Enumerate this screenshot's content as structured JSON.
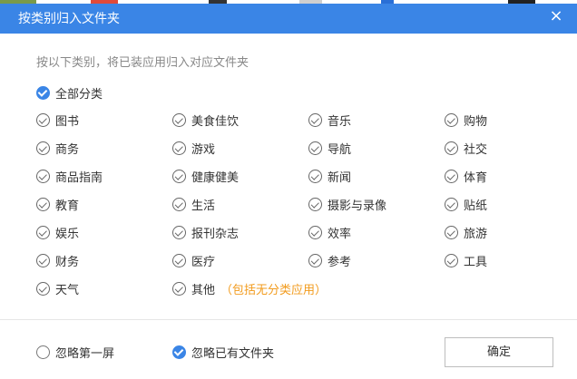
{
  "dialog": {
    "title": "按类别归入文件夹",
    "close_glyph": "×",
    "subtitle": "按以下类别，将已装应用归入对应文件夹",
    "select_all": {
      "label": "全部分类",
      "checked": true
    },
    "categories": [
      {
        "label": "图书",
        "checked": true
      },
      {
        "label": "美食佳饮",
        "checked": true
      },
      {
        "label": "音乐",
        "checked": true
      },
      {
        "label": "购物",
        "checked": true
      },
      {
        "label": "商务",
        "checked": true
      },
      {
        "label": "游戏",
        "checked": true
      },
      {
        "label": "导航",
        "checked": true
      },
      {
        "label": "社交",
        "checked": true
      },
      {
        "label": "商品指南",
        "checked": true
      },
      {
        "label": "健康健美",
        "checked": true
      },
      {
        "label": "新闻",
        "checked": true
      },
      {
        "label": "体育",
        "checked": true
      },
      {
        "label": "教育",
        "checked": true
      },
      {
        "label": "生活",
        "checked": true
      },
      {
        "label": "摄影与录像",
        "checked": true
      },
      {
        "label": "贴纸",
        "checked": true
      },
      {
        "label": "娱乐",
        "checked": true
      },
      {
        "label": "报刊杂志",
        "checked": true
      },
      {
        "label": "效率",
        "checked": true
      },
      {
        "label": "旅游",
        "checked": true
      },
      {
        "label": "财务",
        "checked": true
      },
      {
        "label": "医疗",
        "checked": true
      },
      {
        "label": "参考",
        "checked": true
      },
      {
        "label": "工具",
        "checked": true
      },
      {
        "label": "天气",
        "checked": true
      },
      {
        "label": "其他",
        "checked": true,
        "note": "（包括无分类应用）"
      }
    ],
    "options": {
      "ignore_first_screen": {
        "label": "忽略第一屏",
        "checked": false
      },
      "ignore_existing_folders": {
        "label": "忽略已有文件夹",
        "checked": true
      }
    },
    "confirm_label": "确定"
  },
  "colors": {
    "accent": "#3a85e6",
    "note": "#f29b1d",
    "text": "#333333",
    "muted": "#888888"
  }
}
